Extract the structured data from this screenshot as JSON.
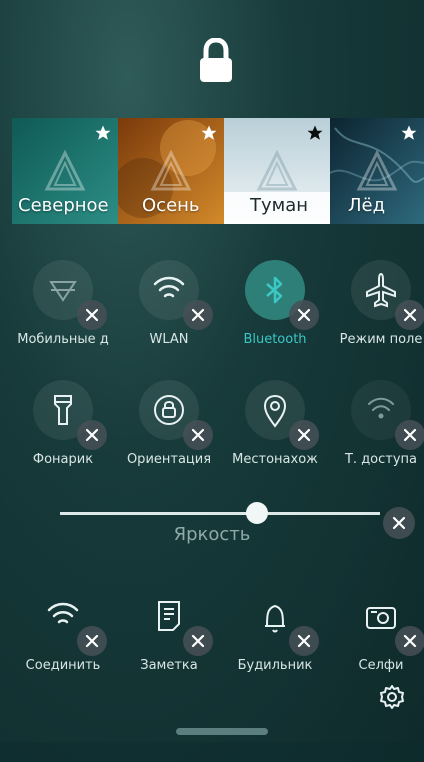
{
  "lock_screen": {
    "icon": "lock-icon"
  },
  "ambiences": [
    {
      "label": "Северное",
      "favorite": true,
      "colors": [
        "#0f5a55",
        "#2c8e86"
      ]
    },
    {
      "label": "Осень",
      "favorite": true,
      "colors": [
        "#7a3a0b",
        "#d38a2a"
      ]
    },
    {
      "label": "Туман",
      "favorite": true,
      "colors": [
        "#b9cfd8",
        "#eef4f6"
      ]
    },
    {
      "label": "Лёд",
      "favorite": true,
      "colors": [
        "#0d2431",
        "#2e6a7d"
      ]
    }
  ],
  "toggles_row1": [
    {
      "label": "Мобильные д",
      "icon": "mobile-data-icon",
      "active": false
    },
    {
      "label": "WLAN",
      "icon": "wifi-icon",
      "active": false
    },
    {
      "label": "Bluetooth",
      "icon": "bluetooth-icon",
      "active": true
    },
    {
      "label": "Режим поле",
      "icon": "airplane-icon",
      "active": false
    }
  ],
  "toggles_row2": [
    {
      "label": "Фонарик",
      "icon": "flashlight-icon",
      "active": false
    },
    {
      "label": "Ориентация",
      "icon": "orientation-lock-icon",
      "active": false
    },
    {
      "label": "Местонахож",
      "icon": "location-pin-icon",
      "active": false
    },
    {
      "label": "Т. доступа",
      "icon": "hotspot-icon",
      "active": false
    }
  ],
  "brightness": {
    "label": "Яркость",
    "level": 0.6
  },
  "shortcuts": [
    {
      "label": "Соединить",
      "icon": "wifi-connect-icon"
    },
    {
      "label": "Заметка",
      "icon": "note-icon"
    },
    {
      "label": "Будильник",
      "icon": "bell-icon"
    },
    {
      "label": "Селфи",
      "icon": "camera-icon"
    }
  ],
  "colors": {
    "accent": "#39c8c4",
    "active_circle": "#2f7f79",
    "bg": "#173a3a"
  }
}
